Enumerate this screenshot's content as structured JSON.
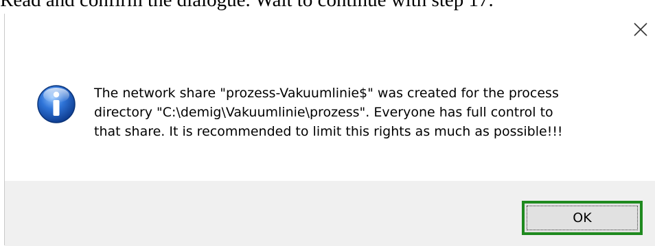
{
  "instruction": {
    "text": "Read and confirm the dialogue. Wait to continue with step 17."
  },
  "dialog": {
    "close_icon": "close-icon",
    "info_icon": "info-icon",
    "message_lines": [
      "The network share \"prozess-Vakuumlinie$\" was created for the process",
      "directory \"C:\\demig\\Vakuumlinie\\prozess\". Everyone has full control to",
      "that share. It is recommended to limit this rights as much as possible!!!"
    ],
    "ok_label": "OK",
    "highlight_color": "#1f8a1f"
  }
}
